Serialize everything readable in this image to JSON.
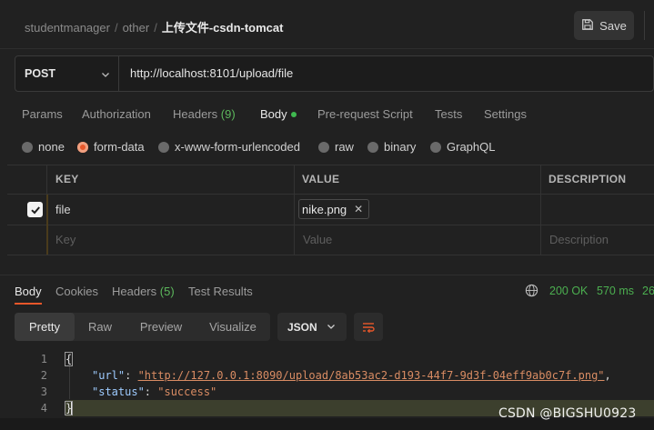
{
  "breadcrumb": {
    "parts": [
      "studentmanager",
      "other"
    ],
    "separator": "/",
    "current": "上传文件-csdn-tomcat"
  },
  "toolbar": {
    "save_label": "Save"
  },
  "request": {
    "method": "POST",
    "url": "http://localhost:8101/upload/file"
  },
  "request_tabs": {
    "params": "Params",
    "authorization": "Authorization",
    "headers": "Headers",
    "headers_count": "(9)",
    "body": "Body",
    "pre_request": "Pre-request Script",
    "tests": "Tests",
    "settings": "Settings"
  },
  "body_types": {
    "none": "none",
    "form_data": "form-data",
    "urlencoded": "x-www-form-urlencoded",
    "raw": "raw",
    "binary": "binary",
    "graphql": "GraphQL",
    "selected": "form-data"
  },
  "table": {
    "headers": {
      "key": "KEY",
      "value": "VALUE",
      "description": "DESCRIPTION"
    },
    "row": {
      "checked": true,
      "key": "file",
      "value": "nike.png",
      "remove": "✕"
    },
    "placeholders": {
      "key": "Key",
      "value": "Value",
      "description": "Description"
    }
  },
  "response_tabs": {
    "body": "Body",
    "cookies": "Cookies",
    "headers": "Headers",
    "headers_count": "(5)",
    "test_results": "Test Results"
  },
  "status": {
    "code": "200 OK",
    "time": "570 ms",
    "size": "26"
  },
  "view_modes": {
    "pretty": "Pretty",
    "raw": "Raw",
    "preview": "Preview",
    "visualize": "Visualize"
  },
  "format": "JSON",
  "code": {
    "line_numbers": [
      "1",
      "2",
      "3",
      "4"
    ],
    "open": "{",
    "close": "}",
    "url_key": "\"url\"",
    "url_value": "\"http://127.0.0.1:8090/upload/8ab53ac2-d193-44f7-9d3f-04eff9ab0c7f.png\"",
    "status_key": "\"status\"",
    "status_value": "\"success\""
  },
  "watermark": "CSDN @BIGSHU0923",
  "colors": {
    "accent": "#e8572a",
    "success": "#4caf50",
    "count": "#5cb85c"
  }
}
